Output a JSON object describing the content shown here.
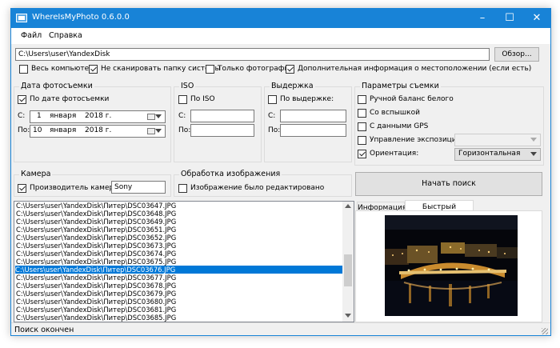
{
  "window": {
    "title": "WhereIsMyPhoto 0.6.0.0"
  },
  "menu": [
    "Файл",
    "Справка"
  ],
  "path": {
    "value": "C:\\Users\\user\\YandexDisk",
    "browse_label": "Обзор..."
  },
  "options": [
    {
      "label": "Весь компьютер",
      "checked": false
    },
    {
      "label": "Не сканировать папку системы",
      "checked": true
    },
    {
      "label": "Только фотографии",
      "checked": false
    },
    {
      "label": "Дополнительная информация о местоположении (если есть)",
      "checked": true
    }
  ],
  "date_group": {
    "title": "Дата фотосъемки",
    "checkbox_label": "По дате фотосъемки",
    "from_label": "С:",
    "from": {
      "day": "1",
      "month": "января",
      "year": "2018 г."
    },
    "to_label": "По:",
    "to": {
      "day": "10",
      "month": "января",
      "year": "2018 г."
    }
  },
  "iso_group": {
    "title": "ISO",
    "checkbox_label": "По ISO",
    "from_label": "С:",
    "to_label": "По:"
  },
  "exposure_group": {
    "title": "Выдержка",
    "checkbox_label": "По выдержке:",
    "from_label": "С:",
    "to_label": "По:"
  },
  "params_group": {
    "title": "Параметры съемки",
    "items": [
      {
        "label": "Ручной баланс белого",
        "checked": false
      },
      {
        "label": "Со вспышкой",
        "checked": false
      },
      {
        "label": "С данными GPS",
        "checked": false
      },
      {
        "label": "Управление экспозицией:",
        "checked": false
      },
      {
        "label": "Ориентация:",
        "checked": true
      }
    ],
    "orientation_value": "Горизонтальная"
  },
  "camera_group": {
    "title": "Камера",
    "checkbox_label": "Производитель камеры:",
    "value": "Sony"
  },
  "processing_group": {
    "title": "Обработка изображения",
    "checkbox_label": "Изображение было редактировано"
  },
  "search_button": "Начать поиск",
  "results": [
    "C:\\Users\\user\\YandexDisk\\Питер\\DSC03647.JPG",
    "C:\\Users\\user\\YandexDisk\\Питер\\DSC03648.JPG",
    "C:\\Users\\user\\YandexDisk\\Питер\\DSC03649.JPG",
    "C:\\Users\\user\\YandexDisk\\Питер\\DSC03651.JPG",
    "C:\\Users\\user\\YandexDisk\\Питер\\DSC03652.JPG",
    "C:\\Users\\user\\YandexDisk\\Питер\\DSC03673.JPG",
    "C:\\Users\\user\\YandexDisk\\Питер\\DSC03674.JPG",
    "C:\\Users\\user\\YandexDisk\\Питер\\DSC03675.JPG",
    "C:\\Users\\user\\YandexDisk\\Питер\\DSC03676.JPG",
    "C:\\Users\\user\\YandexDisk\\Питер\\DSC03677.JPG",
    "C:\\Users\\user\\YandexDisk\\Питер\\DSC03678.JPG",
    "C:\\Users\\user\\YandexDisk\\Питер\\DSC03679.JPG",
    "C:\\Users\\user\\YandexDisk\\Питер\\DSC03680.JPG",
    "C:\\Users\\user\\YandexDisk\\Питер\\DSC03681.JPG",
    "C:\\Users\\user\\YandexDisk\\Питер\\DSC03685.JPG"
  ],
  "selected_result": "C:\\Users\\user\\YandexDisk\\Питер\\DSC03676.JPG",
  "tabs": [
    "Информация",
    "Быстрый просмотр"
  ],
  "active_tab": "Быстрый просмотр",
  "status": "Поиск окончен",
  "accent": "#0078d7"
}
